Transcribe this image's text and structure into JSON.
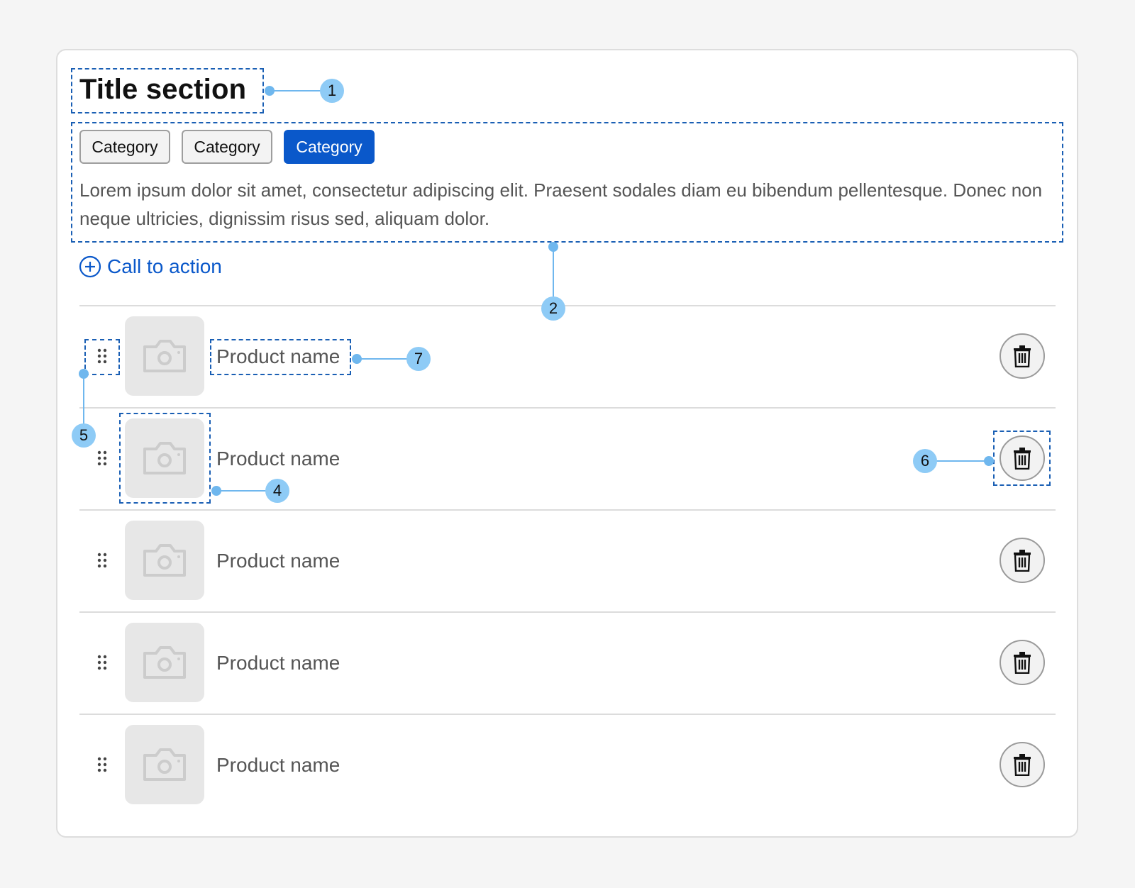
{
  "section": {
    "title": "Title section",
    "categories": [
      {
        "label": "Category",
        "selected": false
      },
      {
        "label": "Category",
        "selected": false
      },
      {
        "label": "Category",
        "selected": true
      }
    ],
    "description": "Lorem ipsum dolor sit amet, consectetur adipiscing elit. Praesent sodales diam eu bibendum pellentesque. Donec non neque ultricies, dignissim risus sed, aliquam dolor.",
    "cta_label": "Call to action"
  },
  "products": [
    {
      "name": "Product name"
    },
    {
      "name": "Product name"
    },
    {
      "name": "Product name"
    },
    {
      "name": "Product name"
    },
    {
      "name": "Product name"
    }
  ],
  "annotations": {
    "title": "1",
    "content": "2",
    "thumbnail": "4",
    "drag": "5",
    "delete": "6",
    "name": "7"
  },
  "icons": {
    "cta": "plus-circle-icon",
    "thumbnail": "camera-icon",
    "drag": "drag-handle-icon",
    "delete": "trash-icon"
  },
  "colors": {
    "accent": "#0a58ca",
    "annotation": "#8ecbf6",
    "guide": "#1a5fb4"
  }
}
